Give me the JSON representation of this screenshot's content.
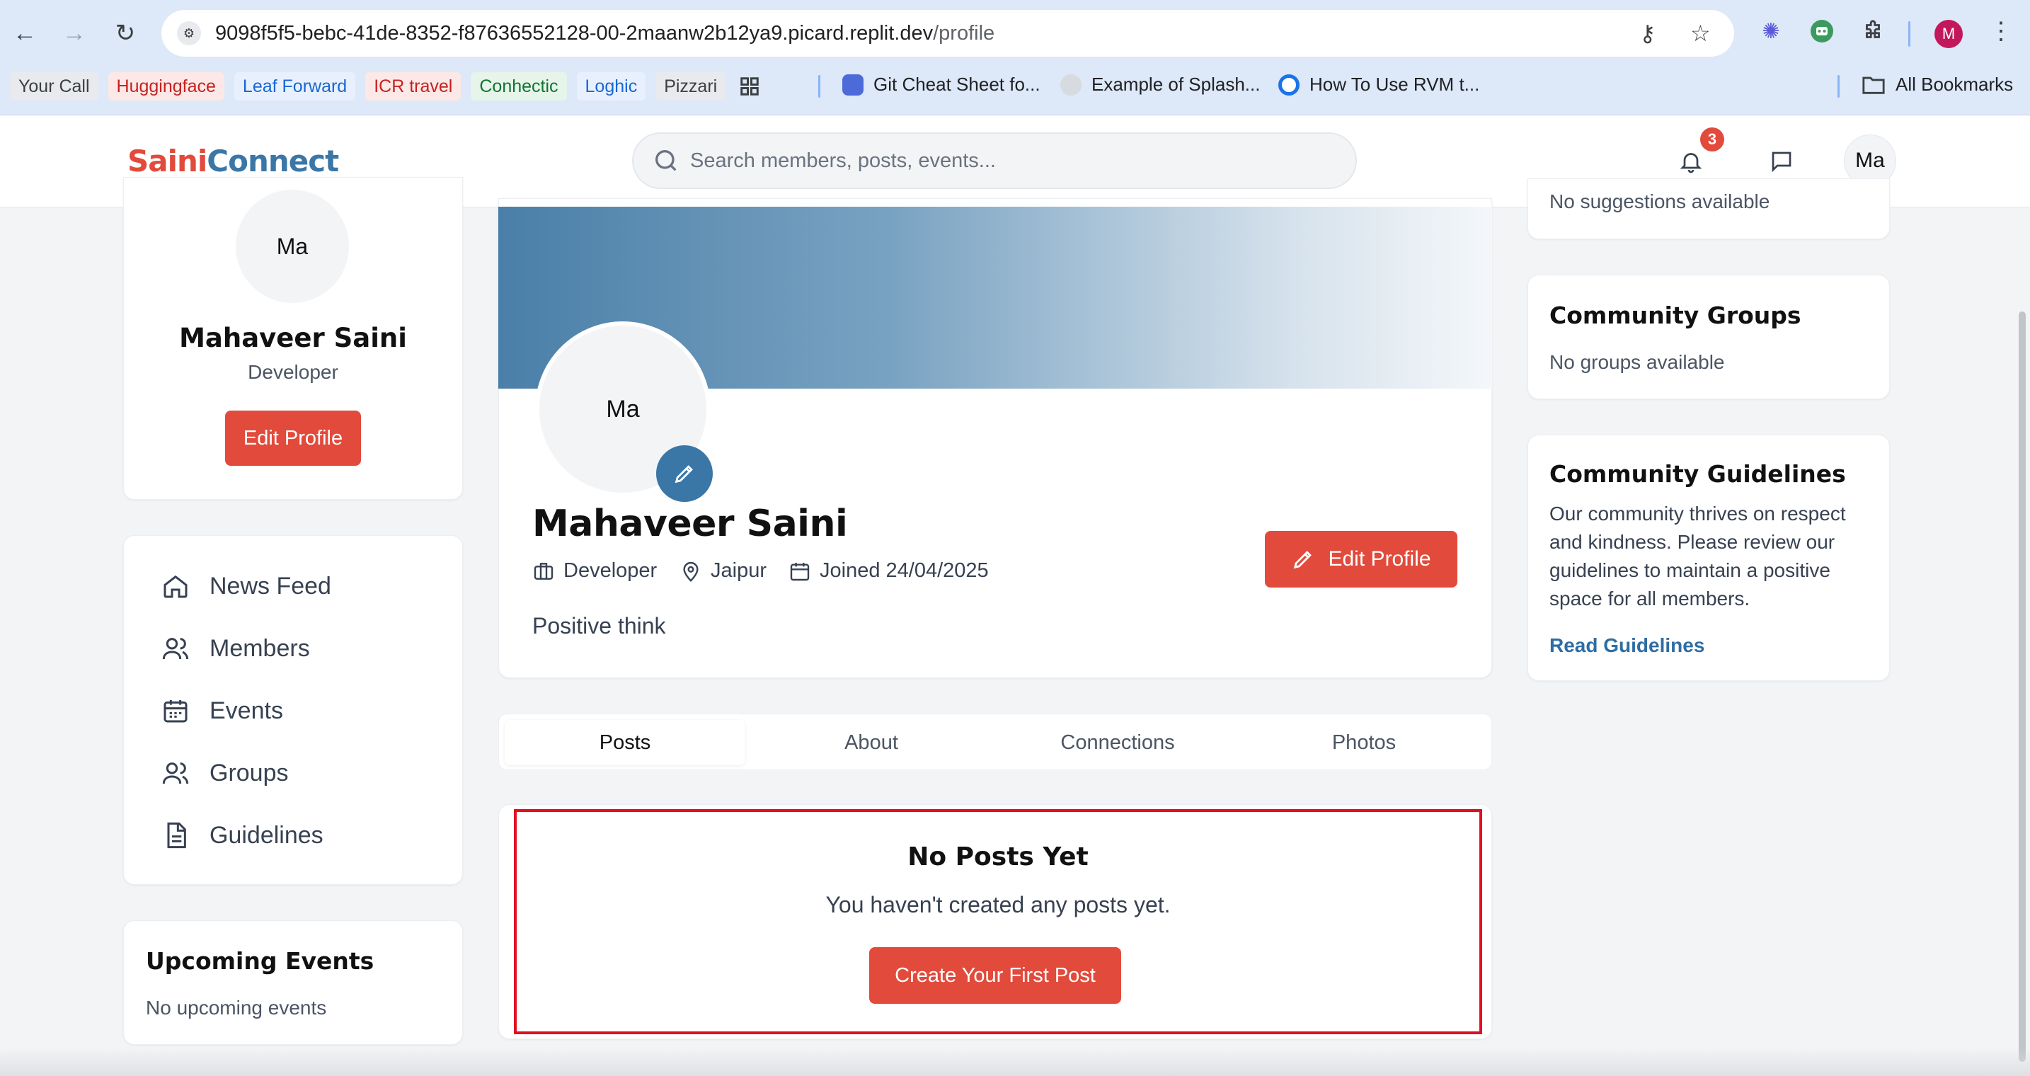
{
  "browser": {
    "url_host": "9098f5f5-bebc-41de-8352-f87636552128-00-2maanw2b12ya9.picard.replit.dev",
    "url_path": "/profile",
    "profile_initial": "M",
    "bookmarks_chips": [
      {
        "label": "Your Call",
        "bg": "#e8eaed",
        "fg": "#3c4043"
      },
      {
        "label": "Huggingface",
        "bg": "#fce8e6",
        "fg": "#c5221f"
      },
      {
        "label": "Leaf Forward",
        "bg": "#e8f0fe",
        "fg": "#1967d2"
      },
      {
        "label": "ICR travel",
        "bg": "#fce8e6",
        "fg": "#c5221f"
      },
      {
        "label": "Conhectic",
        "bg": "#e6f4ea",
        "fg": "#137333"
      },
      {
        "label": "Loghic",
        "bg": "#e8f0fe",
        "fg": "#1967d2"
      },
      {
        "label": "Pizzari",
        "bg": "#e8eaed",
        "fg": "#3c4043"
      }
    ],
    "bookmark_links": [
      "Git Cheat Sheet fo...",
      "Example of Splash...",
      "How To Use RVM t..."
    ],
    "all_bookmarks": "All Bookmarks"
  },
  "header": {
    "logo_part1": "Saini",
    "logo_part2": "Connect",
    "search_placeholder": "Search members, posts, events...",
    "notification_count": "3",
    "avatar_initials": "Ma"
  },
  "left_profile": {
    "avatar_initials": "Ma",
    "name": "Mahaveer Saini",
    "role": "Developer",
    "edit_label": "Edit Profile"
  },
  "menu": [
    {
      "label": "News Feed",
      "icon": "home-icon"
    },
    {
      "label": "Members",
      "icon": "users-icon"
    },
    {
      "label": "Events",
      "icon": "calendar-icon"
    },
    {
      "label": "Groups",
      "icon": "groups-icon"
    },
    {
      "label": "Guidelines",
      "icon": "document-icon"
    }
  ],
  "upcoming_events": {
    "title": "Upcoming Events",
    "empty": "No upcoming events"
  },
  "profile": {
    "avatar_initials": "Ma",
    "name": "Mahaveer Saini",
    "role": "Developer",
    "location": "Jaipur",
    "joined": "Joined 24/04/2025",
    "bio": "Positive think",
    "edit_label": "Edit Profile"
  },
  "tabs": [
    "Posts",
    "About",
    "Connections",
    "Photos"
  ],
  "posts_empty": {
    "title": "No Posts Yet",
    "subtitle": "You haven't created any posts yet.",
    "button": "Create Your First Post"
  },
  "right": {
    "suggestions_empty": "No suggestions available",
    "groups_title": "Community Groups",
    "groups_empty": "No groups available",
    "guidelines_title": "Community Guidelines",
    "guidelines_text": "Our community thrives on respect and kindness. Please review our guidelines to maintain a positive space for all members.",
    "guidelines_link": "Read Guidelines"
  },
  "colors": {
    "brand_red": "#e24a3b",
    "brand_blue": "#3a76a6",
    "highlight_border": "#e01021"
  }
}
